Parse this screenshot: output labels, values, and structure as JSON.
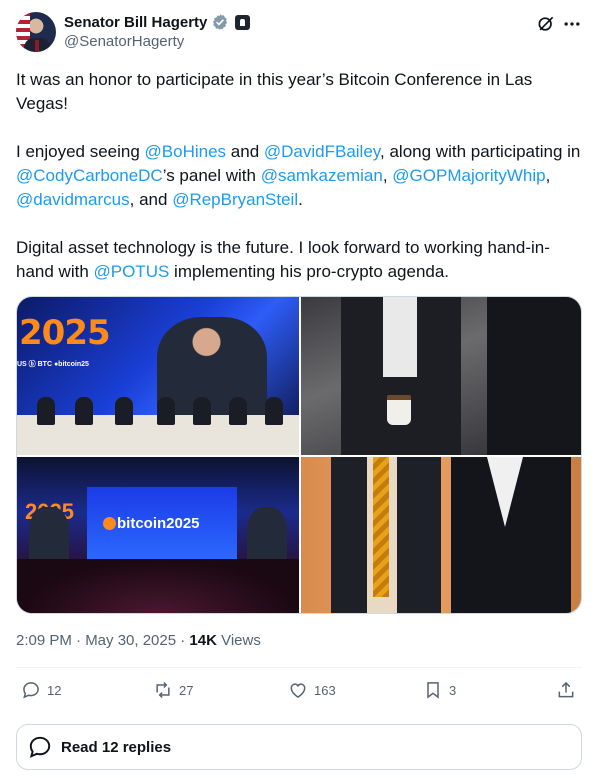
{
  "author": {
    "name": "Senator Bill Hagerty",
    "handle": "@SenatorHagerty",
    "verified_color": "#829aab"
  },
  "tweet": {
    "p1": "It was an honor to participate in this year’s Bitcoin Conference in Las Vegas!",
    "p2": {
      "t1": "I enjoyed seeing ",
      "m1": "@BoHines",
      "t2": " and ",
      "m2": "@DavidFBailey",
      "t3": ", along with participating in ",
      "m3": "@CodyCarboneDC",
      "t4": "’s panel with ",
      "m4": "@samkazemian",
      "t5": ", ",
      "m5": "@GOPMajorityWhip",
      "t6": ", ",
      "m6": "@davidmarcus",
      "t7": ", and ",
      "m7": "@RepBryanSteil",
      "t8": "."
    },
    "p3": {
      "t1": "Digital asset technology is the future. I look forward to working hand-in-hand with ",
      "m1": "@POTUS",
      "t2": " implementing his pro-crypto agenda."
    }
  },
  "media": {
    "photo1_text": "2025",
    "photo1_logos": "US  ⓑ BTC  ●bitcoin25",
    "photo3_big": "2025",
    "photo3_logo": "bitcoin2025"
  },
  "meta": {
    "time_date": "2:09 PM · May 30, 2025 · ",
    "views_count": "14K",
    "views_label": " Views"
  },
  "actions": {
    "replies": "12",
    "reposts": "27",
    "likes": "163",
    "bookmarks": "3"
  },
  "read_replies": "Read 12 replies",
  "colors": {
    "accent": "#1d9bf0",
    "text": "#0f1419",
    "muted": "#536471"
  }
}
